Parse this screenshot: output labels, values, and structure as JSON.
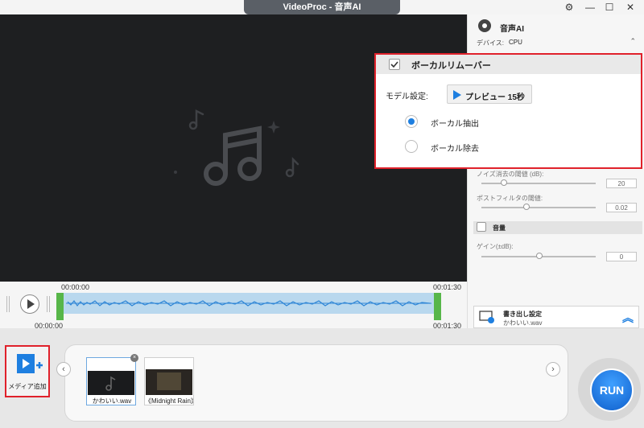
{
  "window": {
    "title": "VideoProc - 音声AI"
  },
  "timeline": {
    "start_top": "00:00:00",
    "end_top": "00:01:30",
    "start_bottom": "00:00:00",
    "end_bottom": "00:01:30"
  },
  "panel": {
    "title": "音声AI",
    "device_label": "デバイス:",
    "device_value": "CPU",
    "noise_label": "ノイズ消去の閾値 (dB):",
    "noise_value": "20",
    "post_label": "ポストフィルタの閾値:",
    "post_value": "0.02",
    "volume_label": "音量",
    "gain_label": "ゲイン(±dB):",
    "gain_value": "0",
    "export_title": "書き出し設定",
    "export_file": "かわいい.wav"
  },
  "vocal": {
    "title": "ボーカルリムーバー",
    "model_label": "モデル設定:",
    "preview_button": "プレビュー 15秒",
    "option_extract": "ボーカル抽出",
    "option_remove": "ボーカル除去",
    "selected": "ボーカル抽出"
  },
  "media": {
    "add_label": "メディア追加",
    "items": [
      {
        "label": "かわいい.wav"
      },
      {
        "label": "《Midnight Rain》"
      }
    ]
  },
  "run_label": "RUN",
  "colors": {
    "accent": "#1e7fe0",
    "highlight": "#e0212b",
    "wave": "#2f86d6",
    "handle": "#57b649"
  }
}
